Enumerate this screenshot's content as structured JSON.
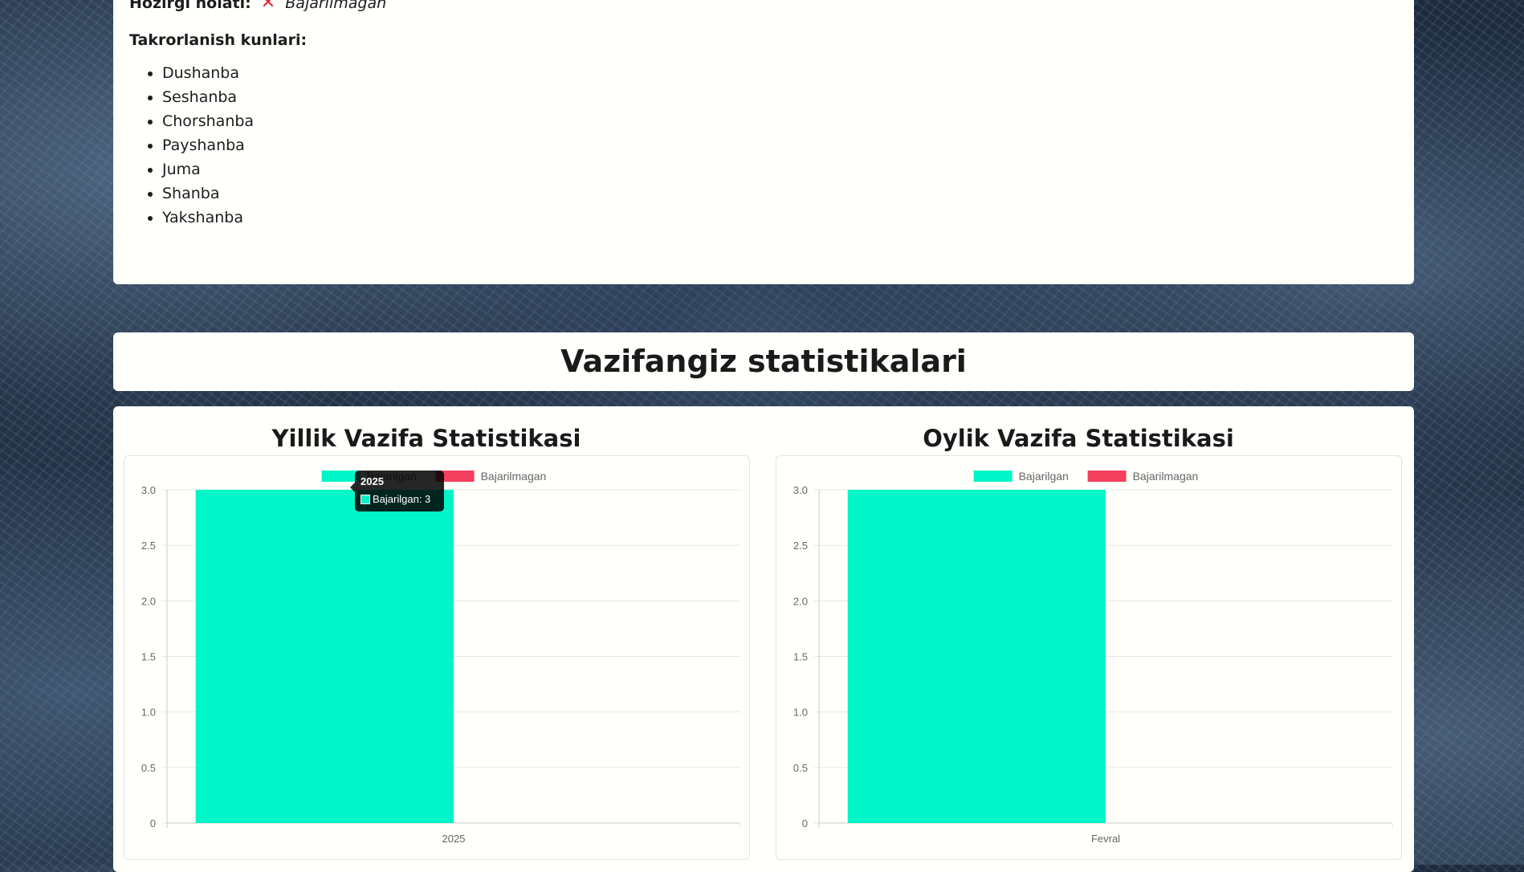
{
  "task": {
    "status_label": "Hozirgi holati:",
    "status_icon": "cross-mark-icon",
    "status_value": "Bajarilmagan",
    "status_color": "#e0262d",
    "days_heading": "Takrorlanish kunlari:",
    "days": [
      "Dushanba",
      "Seshanba",
      "Chorshanba",
      "Payshanba",
      "Juma",
      "Shanba",
      "Yakshanba"
    ]
  },
  "stats": {
    "title": "Vazifangiz statistikalari"
  },
  "chart_data": [
    {
      "type": "bar",
      "title": "Yillik Vazifa Statistikasi",
      "categories": [
        "2025"
      ],
      "series": [
        {
          "name": "Bajarilgan",
          "values": [
            3
          ],
          "color": "#00f5c8"
        },
        {
          "name": "Bajarilmagan",
          "values": [
            0
          ],
          "color": "#f43f5e"
        }
      ],
      "yticks": [
        "0",
        "0.5",
        "1.0",
        "1.5",
        "2.0",
        "2.5",
        "3.0"
      ],
      "ylim": [
        0,
        3
      ],
      "grid": true,
      "legend": "top",
      "tooltip": {
        "title": "2025",
        "label": "Bajarilgan: 3"
      }
    },
    {
      "type": "bar",
      "title": "Oylik Vazifa Statistikasi",
      "categories": [
        "Fevral"
      ],
      "series": [
        {
          "name": "Bajarilgan",
          "values": [
            3
          ],
          "color": "#00f5c8"
        },
        {
          "name": "Bajarilmagan",
          "values": [
            0
          ],
          "color": "#f43f5e"
        }
      ],
      "yticks": [
        "0",
        "0.5",
        "1.0",
        "1.5",
        "2.0",
        "2.5",
        "3.0"
      ],
      "ylim": [
        0,
        3
      ],
      "grid": true,
      "legend": "top"
    }
  ]
}
